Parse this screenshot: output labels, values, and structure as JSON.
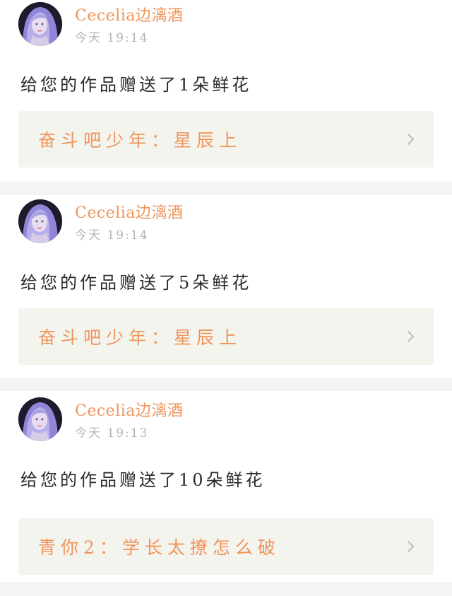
{
  "colors": {
    "accent": "#f0955b",
    "background": "#f4f4f2",
    "card": "#ffffff",
    "link_bg": "#f4f4ee",
    "time": "#b4b4b4",
    "chevron": "#bdbdbd"
  },
  "notifications": [
    {
      "username": "Cecelia边漓酒",
      "time": "今天  19:14",
      "message": "给您的作品赠送了1朵鲜花",
      "work_title": "奋斗吧少年：星辰上",
      "avatar_icon": "user-avatar",
      "chevron_icon": "chevron-right-icon"
    },
    {
      "username": "Cecelia边漓酒",
      "time": "今天  19:14",
      "message": "给您的作品赠送了5朵鲜花",
      "work_title": "奋斗吧少年：星辰上",
      "avatar_icon": "user-avatar",
      "chevron_icon": "chevron-right-icon"
    },
    {
      "username": "Cecelia边漓酒",
      "time": "今天  19:13",
      "message": "给您的作品赠送了10朵鲜花",
      "work_title": "青你2：学长太撩怎么破",
      "avatar_icon": "user-avatar",
      "chevron_icon": "chevron-right-icon"
    }
  ]
}
